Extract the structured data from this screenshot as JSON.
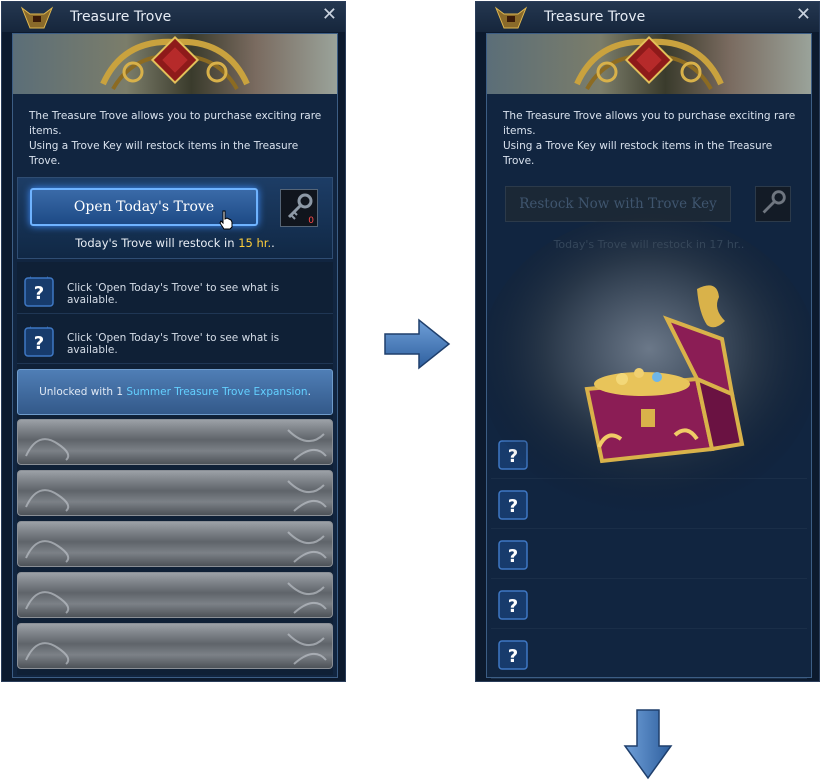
{
  "window": {
    "title": "Treasure Trove"
  },
  "left": {
    "description": [
      "The Treasure Trove allows you to purchase exciting rare items.",
      "Using a Trove Key will restock items in the Treasure Trove."
    ],
    "open_button": "Open Today's Trove",
    "key_count": "0",
    "restock_prefix": "Today's Trove will restock in ",
    "restock_time": "15 hr.",
    "restock_suffix": ".",
    "rows": [
      {
        "text": "Click 'Open Today's Trove' to see what is available."
      },
      {
        "text": "Click 'Open Today's Trove' to see what is available."
      }
    ],
    "unlock_prefix": "Unlocked with 1 ",
    "unlock_link": "Summer Treasure Trove Expansion",
    "unlock_suffix": "."
  },
  "right": {
    "restock_button": "Restock Now with Trove Key",
    "restock_text": "Today's Trove will restock in 17 hr.."
  },
  "colors": {
    "highlight": "#ffce3a",
    "link": "#63d0ff",
    "key_count": "#ff4a4a"
  },
  "icons": {
    "title": "bull-mask-icon",
    "close": "close-icon",
    "key": "trove-key-icon",
    "row": "question-mark-icon",
    "chest": "treasure-chest-icon",
    "arrows": [
      "arrow-right-icon",
      "arrow-down-icon"
    ]
  }
}
